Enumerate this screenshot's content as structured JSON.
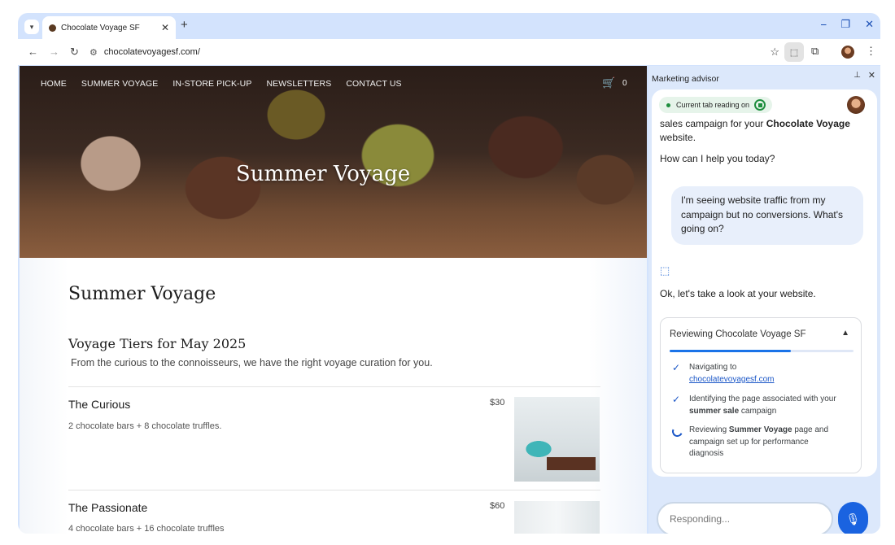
{
  "browser": {
    "tab": {
      "title": "Chocolate Voyage SF",
      "close": "✕"
    },
    "new_tab": "+",
    "window_controls": {
      "minimize": "⎯",
      "restore": "❐",
      "close": "✕"
    },
    "nav": {
      "back": "←",
      "forward": "→",
      "reload": "↻"
    },
    "url": "chocolatevoyagesf.com/",
    "icons": {
      "tab_menu": "chevron-down-icon",
      "bookmark": "star-icon",
      "ai": "gemini-tab-icon",
      "extensions": "puzzle-icon",
      "menu": "kebab-menu-icon"
    }
  },
  "site": {
    "nav": [
      "HOME",
      "SUMMER VOYAGE",
      "IN-STORE PICK-UP",
      "NEWSLETTERS",
      "CONTACT US"
    ],
    "cart_count": "0",
    "hero_title": "Summer Voyage",
    "page_title": "Summer Voyage",
    "tiers_title": "Voyage Tiers for May 2025",
    "tiers_subtitle": "From the curious to the connoisseurs, we have the right voyage curation for you.",
    "tiers": [
      {
        "name": "The Curious",
        "desc": "2 chocolate bars + 8 chocolate truffles.",
        "price": "$30"
      },
      {
        "name": "The Passionate",
        "desc": "4 chocolate bars + 16 chocolate truffles",
        "price": "$60"
      }
    ]
  },
  "panel": {
    "title": "Marketing advisor",
    "pin": "⊥",
    "close": "✕",
    "status_pill": "Current tab reading on",
    "assistant_intro_1": "sales campaign for your ",
    "assistant_intro_brand": "Chocolate Voyage",
    "assistant_intro_2": "website.",
    "assistant_greeting": "How can I help you today?",
    "user_message": "I'm seeing website traffic from my campaign but no conversions. What's going on?",
    "assistant_reply": "Ok, let's take a look at your website.",
    "review": {
      "title": "Reviewing Chocolate Voyage SF",
      "progress": 0.66,
      "steps": [
        {
          "status": "done",
          "text": "Navigating to",
          "link": "chocolatevoyagesf.com"
        },
        {
          "status": "done",
          "text_pre": "Identifying the page associated with your ",
          "text_bold": "summer sale",
          "text_post": " campaign"
        },
        {
          "status": "in-progress",
          "text_pre": "Reviewing ",
          "text_bold": "Summer Voyage",
          "text_post": " page and campaign set up for performance diagnosis"
        }
      ]
    },
    "composer_placeholder": "Responding...",
    "accent": "#1a73e8"
  }
}
